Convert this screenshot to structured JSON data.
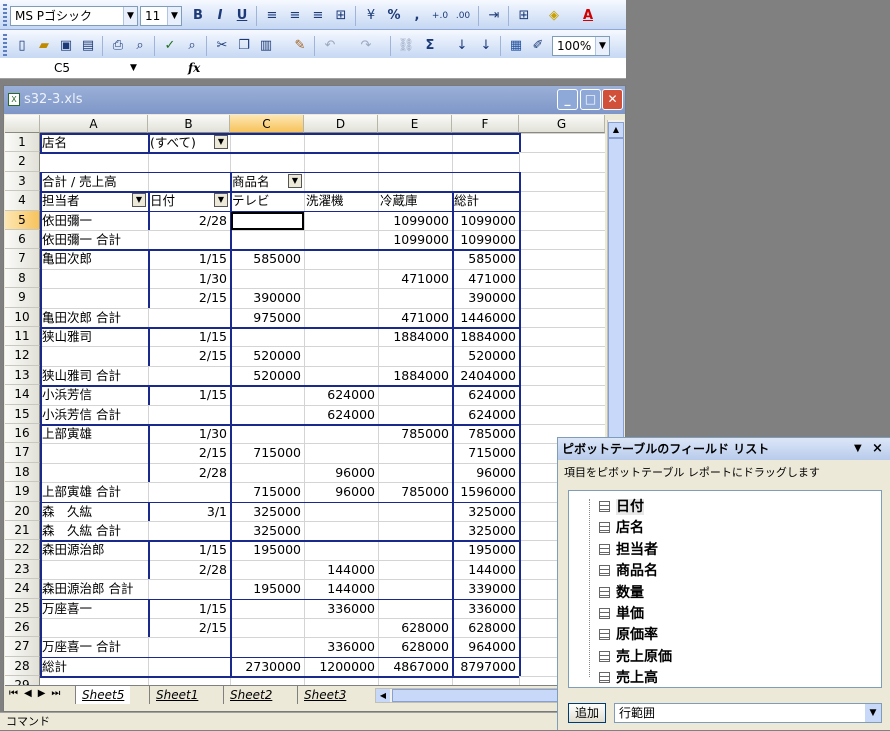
{
  "toolbar1": {
    "font_name": "MS Pゴシック",
    "font_size": "11",
    "bold": "B",
    "italic": "I",
    "underline": "U",
    "percent": "%",
    "comma": ",",
    "inc_decimal": "+.0",
    "dec_decimal": ".00"
  },
  "toolbar2": {
    "zoom": "100%",
    "sigma": "Σ"
  },
  "formula_bar": {
    "name_box": "C5",
    "fx": "fx",
    "value": ""
  },
  "window": {
    "title": "s32-3.xls",
    "min": "_",
    "max": "□",
    "close": "✕"
  },
  "columns": [
    "A",
    "B",
    "C",
    "D",
    "E",
    "F",
    "G"
  ],
  "rows": [
    "1",
    "2",
    "3",
    "4",
    "5",
    "6",
    "7",
    "8",
    "9",
    "10",
    "11",
    "12",
    "13",
    "14",
    "15",
    "16",
    "17",
    "18",
    "19",
    "20",
    "21",
    "22",
    "23",
    "24",
    "25",
    "26",
    "27",
    "28",
    "29"
  ],
  "sheet": {
    "r1": {
      "a": "店名",
      "b": "(すべて)"
    },
    "r3": {
      "a": "合計 / 売上高",
      "c": "商品名"
    },
    "r4": {
      "a": "担当者",
      "b": "日付",
      "c": "テレビ",
      "d": "洗濯機",
      "e": "冷蔵庫",
      "f": "総計"
    },
    "data": [
      {
        "a": "依田彌一",
        "b": "2/28",
        "c": "",
        "d": "",
        "e": "1099000",
        "f": "1099000"
      },
      {
        "a": "依田彌一 合計",
        "b": "",
        "c": "",
        "d": "",
        "e": "1099000",
        "f": "1099000"
      },
      {
        "a": "亀田次郎",
        "b": "1/15",
        "c": "585000",
        "d": "",
        "e": "",
        "f": "585000"
      },
      {
        "a": "",
        "b": "1/30",
        "c": "",
        "d": "",
        "e": "471000",
        "f": "471000"
      },
      {
        "a": "",
        "b": "2/15",
        "c": "390000",
        "d": "",
        "e": "",
        "f": "390000"
      },
      {
        "a": "亀田次郎 合計",
        "b": "",
        "c": "975000",
        "d": "",
        "e": "471000",
        "f": "1446000"
      },
      {
        "a": "狭山雅司",
        "b": "1/15",
        "c": "",
        "d": "",
        "e": "1884000",
        "f": "1884000"
      },
      {
        "a": "",
        "b": "2/15",
        "c": "520000",
        "d": "",
        "e": "",
        "f": "520000"
      },
      {
        "a": "狭山雅司 合計",
        "b": "",
        "c": "520000",
        "d": "",
        "e": "1884000",
        "f": "2404000"
      },
      {
        "a": "小浜芳信",
        "b": "1/15",
        "c": "",
        "d": "624000",
        "e": "",
        "f": "624000"
      },
      {
        "a": "小浜芳信 合計",
        "b": "",
        "c": "",
        "d": "624000",
        "e": "",
        "f": "624000"
      },
      {
        "a": "上部寅雄",
        "b": "1/30",
        "c": "",
        "d": "",
        "e": "785000",
        "f": "785000"
      },
      {
        "a": "",
        "b": "2/15",
        "c": "715000",
        "d": "",
        "e": "",
        "f": "715000"
      },
      {
        "a": "",
        "b": "2/28",
        "c": "",
        "d": "96000",
        "e": "",
        "f": "96000"
      },
      {
        "a": "上部寅雄 合計",
        "b": "",
        "c": "715000",
        "d": "96000",
        "e": "785000",
        "f": "1596000"
      },
      {
        "a": "森　久紘",
        "b": "3/1",
        "c": "325000",
        "d": "",
        "e": "",
        "f": "325000"
      },
      {
        "a": "森　久紘 合計",
        "b": "",
        "c": "325000",
        "d": "",
        "e": "",
        "f": "325000"
      },
      {
        "a": "森田源治郎",
        "b": "1/15",
        "c": "195000",
        "d": "",
        "e": "",
        "f": "195000"
      },
      {
        "a": "",
        "b": "2/28",
        "c": "",
        "d": "144000",
        "e": "",
        "f": "144000"
      },
      {
        "a": "森田源治郎 合計",
        "b": "",
        "c": "195000",
        "d": "144000",
        "e": "",
        "f": "339000"
      },
      {
        "a": "万座喜一",
        "b": "1/15",
        "c": "",
        "d": "336000",
        "e": "",
        "f": "336000"
      },
      {
        "a": "",
        "b": "2/15",
        "c": "",
        "d": "",
        "e": "628000",
        "f": "628000"
      },
      {
        "a": "万座喜一 合計",
        "b": "",
        "c": "",
        "d": "336000",
        "e": "628000",
        "f": "964000"
      },
      {
        "a": "総計",
        "b": "",
        "c": "2730000",
        "d": "1200000",
        "e": "4867000",
        "f": "8797000"
      }
    ]
  },
  "tabs": [
    "Sheet5",
    "Sheet1",
    "Sheet2",
    "Sheet3"
  ],
  "status": "コマンド",
  "field_list": {
    "title": "ピボットテーブルのフィールド リスト",
    "instruction": "項目をピボットテーブル レポートにドラッグします",
    "fields": [
      "日付",
      "店名",
      "担当者",
      "商品名",
      "数量",
      "単価",
      "原価率",
      "売上原価",
      "売上高"
    ],
    "add_button": "追加",
    "area_select": "行範囲"
  }
}
